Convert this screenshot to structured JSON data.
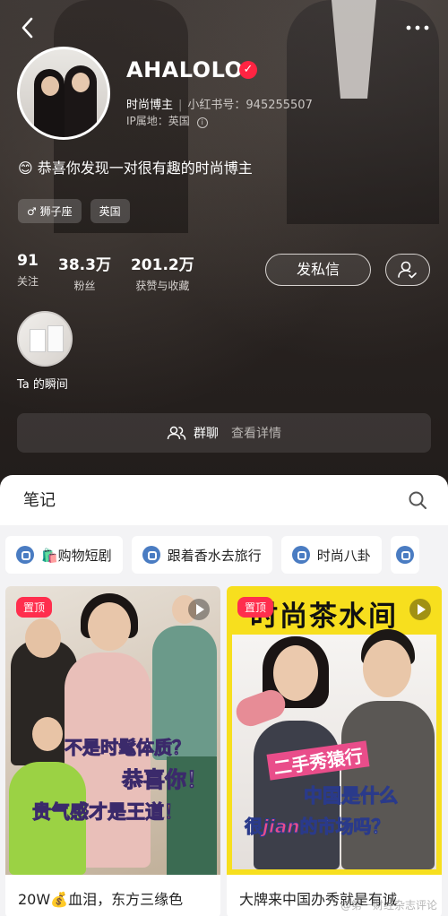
{
  "profile": {
    "name": "AHALOLO",
    "role": "时尚博主",
    "id_label": "小红书号：945255507",
    "ip_location": "IP属地：英国",
    "bio": "😊 恭喜你发现一对很有趣的时尚博主",
    "tags": [
      "♂ 狮子座",
      "英国"
    ]
  },
  "stats": [
    {
      "value": "91",
      "label": "关注"
    },
    {
      "value": "38.3万",
      "label": "粉丝"
    },
    {
      "value": "201.2万",
      "label": "获赞与收藏"
    }
  ],
  "actions": {
    "message_label": "发私信"
  },
  "moment": {
    "label": "Ta 的瞬间"
  },
  "group": {
    "label": "群聊",
    "detail": "查看详情"
  },
  "notes": {
    "title": "笔记",
    "chips": [
      "🛍️购物短剧",
      "跟着香水去旅行",
      "时尚八卦"
    ],
    "cards": [
      {
        "pin": "置顶",
        "overlay_line1": "不是时髦体质？",
        "overlay_line2": "恭喜你！",
        "overlay_line3": "贵气感才是王道！",
        "caption": "20W💰血泪，东方三缘色"
      },
      {
        "pin": "置顶",
        "cover_title": "时尚茶水间",
        "overlay_line1": "二手秀猿行",
        "overlay_line2": "中国是什么",
        "overlay_line3_a": "很",
        "overlay_line3_b": "jian",
        "overlay_line3_c": "的市场吗？",
        "caption": "大牌来中国办秀就是有诚"
      }
    ]
  },
  "watermark": "@第一财经杂志评论",
  "colors": {
    "header_bg": "#231d1b",
    "verified": "#ff2442",
    "pin": "#ff2e4d",
    "chip_icon": "#4a7cc2"
  }
}
